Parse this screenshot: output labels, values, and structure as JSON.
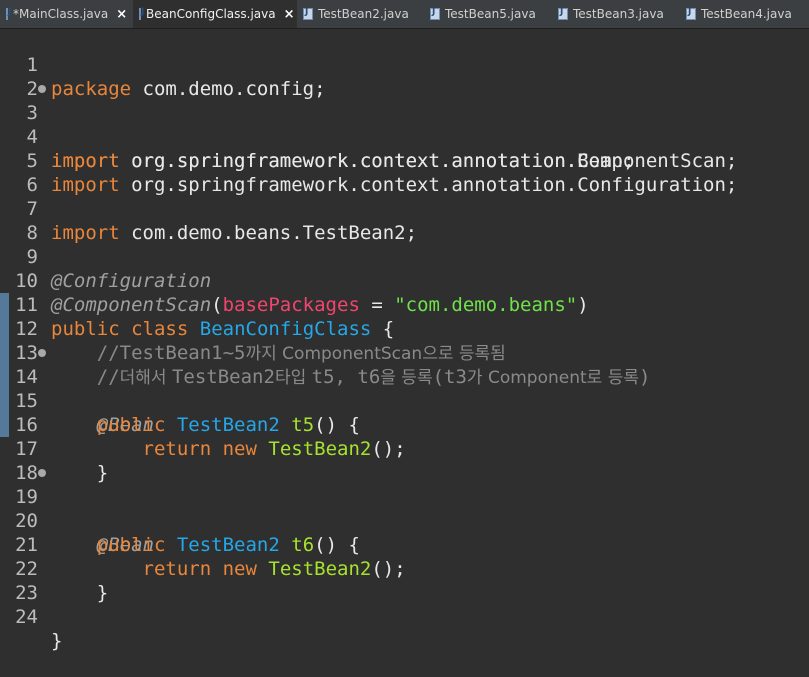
{
  "tabs": [
    {
      "label": "*MainClass.java",
      "close": "×",
      "active": false
    },
    {
      "label": "BeanConfigClass.java",
      "close": "×",
      "active": true
    },
    {
      "label": "TestBean2.java",
      "active": false
    },
    {
      "label": "TestBean5.java",
      "active": false
    },
    {
      "label": "TestBean3.java",
      "active": false
    },
    {
      "label": "TestBean4.java",
      "active": false
    }
  ],
  "editor": {
    "line_numbers": [
      "1",
      "2",
      "3",
      "4",
      "5",
      "6",
      "7",
      "8",
      "9",
      "10",
      "11",
      "12",
      "13",
      "14",
      "15",
      "16",
      "17",
      "18",
      "19",
      "20",
      "21",
      "22",
      "23",
      "24"
    ],
    "lines": {
      "l1": {
        "kw": "package",
        "rest": " com.demo.config;"
      },
      "l3": {
        "kw": "import",
        "rest": " org.springframework.context.annotation.Bean;"
      },
      "l4": {
        "kw": "import",
        "rest": " org.springframework.context.annotation.ComponentScan;"
      },
      "l5": {
        "kw": "import",
        "rest": " org.springframework.context.annotation.Configuration;"
      },
      "l7": {
        "kw": "import",
        "rest": " com.demo.beans.TestBean2;"
      },
      "l9": {
        "ann": "@Configuration"
      },
      "l10": {
        "ann": "@ComponentScan",
        "p1": "(",
        "attr": "basePackages",
        "eq": " = ",
        "str": "\"com.demo.beans\"",
        "p2": ")"
      },
      "l11": {
        "kw1": "public",
        "kw2": "class",
        "cls": "BeanConfigClass",
        "brace": " {"
      },
      "l12": {
        "c1": "//TestBean1~5",
        "c2": "까지 ",
        "c3": "ComponentScan",
        "c4": "으로 등록됨"
      },
      "l13": {
        "c1": "//",
        "c2": "더해서 ",
        "c3": "TestBean2",
        "c4": "타입 ",
        "c5": "t5, t6",
        "c6": "을 등록",
        "c7": "(t3",
        "c8": "가 ",
        "c9": "Component",
        "c10": "로 등록",
        "c11": ")"
      },
      "l14": {
        "ann": "@Bean"
      },
      "l15": {
        "kw": "public",
        "cls": "TestBean2",
        "meth": "t5",
        "rest": "() {"
      },
      "l16": {
        "kw1": "return",
        "kw2": "new",
        "meth": "TestBean2",
        "rest": "();"
      },
      "l17": {
        "rest": "}"
      },
      "l19": {
        "ann": "@Bean"
      },
      "l20": {
        "kw": "public",
        "cls": "TestBean2",
        "meth": "t6",
        "rest": "() {"
      },
      "l21": {
        "kw1": "return",
        "kw2": "new",
        "meth": "TestBean2",
        "rest": "();"
      },
      "l22": {
        "rest": "}"
      },
      "l24": {
        "rest": "}"
      }
    }
  }
}
